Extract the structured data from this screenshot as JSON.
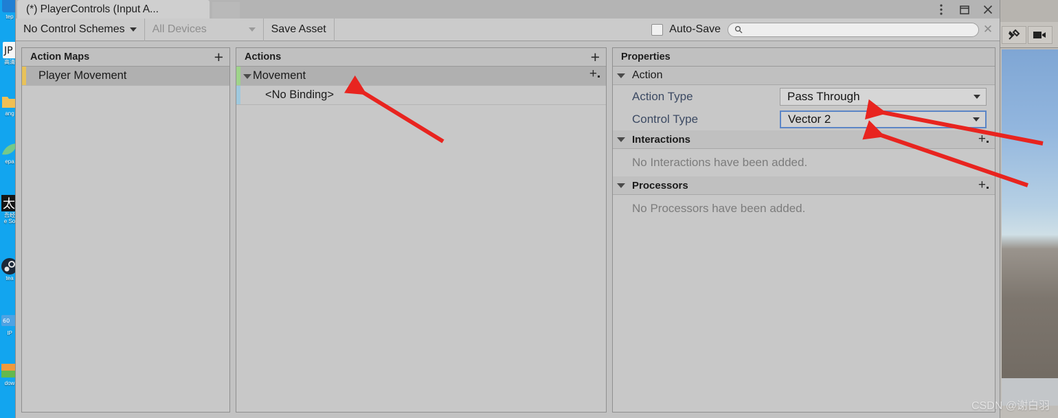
{
  "window": {
    "tab_title": "(*) PlayerControls (Input A...",
    "controls": {
      "menu": "⋮",
      "maximize": "□",
      "close": "✕"
    }
  },
  "toolbar": {
    "control_schemes": "No Control Schemes",
    "devices": "All Devices",
    "save_asset": "Save Asset",
    "auto_save": "Auto-Save",
    "search_value": "",
    "search_placeholder": "",
    "clear_label": "✕"
  },
  "action_maps": {
    "header": "Action Maps",
    "add_label": "+",
    "items": [
      {
        "label": "Player Movement",
        "accent": "#e8c25a",
        "selected": true
      }
    ]
  },
  "actions": {
    "header": "Actions",
    "add_label": "+",
    "items": [
      {
        "label": "Movement",
        "accent": "#9fd48a",
        "selected": true,
        "expanded": true,
        "has_add": true
      },
      {
        "label": "<No Binding>",
        "accent": "#9fc9de",
        "selected": false,
        "expanded": false,
        "has_add": false
      }
    ]
  },
  "properties": {
    "header": "Properties",
    "action": {
      "title": "Action",
      "rows": [
        {
          "label": "Action Type",
          "value": "Pass Through",
          "focused": false
        },
        {
          "label": "Control Type",
          "value": "Vector 2",
          "focused": true
        }
      ]
    },
    "interactions": {
      "title": "Interactions",
      "empty": "No Interactions have been added.",
      "add_label": "+"
    },
    "processors": {
      "title": "Processors",
      "empty": "No Processors have been added.",
      "add_label": "+"
    }
  },
  "desktop_icons": [
    {
      "label": "tep",
      "color": "#1f7fd4"
    },
    {
      "label": "高清",
      "color": "#f2f2f2"
    },
    {
      "label": "ang",
      "color": "#f0bf54"
    },
    {
      "label": "epa",
      "color": "#74c98a"
    },
    {
      "label": "吾经",
      "color": "#1b1b1b"
    },
    {
      "label": "e So",
      "color": "#1b1b1b"
    },
    {
      "label": "tea",
      "color": "#2a3f4d"
    },
    {
      "label": "dow",
      "color": "#f09a3c"
    }
  ],
  "watermark": "CSDN @谢白羽"
}
